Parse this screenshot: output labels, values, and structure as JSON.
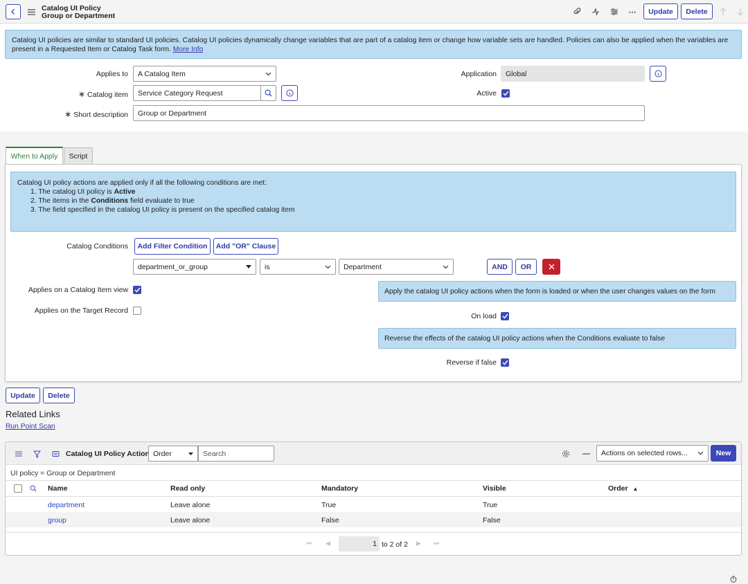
{
  "header": {
    "record_type": "Catalog UI Policy",
    "record_name": "Group or Department",
    "update_label": "Update",
    "delete_label": "Delete"
  },
  "intro_banner": {
    "text": "Catalog UI policies are similar to standard UI policies. Catalog UI policies dynamically change variables that are part of a catalog item or change how variable sets are handled. Policies can also be applied when the variables are present in a Requested Item or Catalog Task form.",
    "link_label": "More Info"
  },
  "form": {
    "applies_to_label": "Applies to",
    "applies_to_value": "A Catalog Item",
    "catalog_item_label": "Catalog item",
    "catalog_item_value": "Service Category Request",
    "short_description_label": "Short description",
    "short_description_value": "Group or Department",
    "application_label": "Application",
    "application_value": "Global",
    "active_label": "Active",
    "required_marker": "∗"
  },
  "tabs": [
    {
      "label": "When to Apply",
      "active": true
    },
    {
      "label": "Script",
      "active": false
    }
  ],
  "conditions_banner": {
    "intro": "Catalog UI policy actions are applied only if all the following conditions are met:",
    "item1_prefix": "1. The catalog UI policy is ",
    "item1_bold": "Active",
    "item2_prefix": "2. The items in the ",
    "item2_bold": "Conditions",
    "item2_suffix": " field evaluate to true",
    "item3": "3. The field specified in the catalog UI policy is present on the specified catalog item"
  },
  "conditions": {
    "label": "Catalog Conditions",
    "add_filter_label": "Add Filter Condition",
    "add_or_label": "Add \"OR\" Clause",
    "field": "department_or_group",
    "operator": "is",
    "value": "Department",
    "and_label": "AND",
    "or_label": "OR"
  },
  "options": {
    "applies_catalog_view_label": "Applies on a Catalog Item view",
    "applies_catalog_view": true,
    "applies_target_label": "Applies on the Target Record",
    "applies_target": false,
    "onload_hint": "Apply the catalog UI policy actions when the form is loaded or when the user changes values on the form",
    "onload_label": "On load",
    "onload": true,
    "reverse_hint": "Reverse the effects of the catalog UI policy actions when the Conditions evaluate to false",
    "reverse_label": "Reverse if false",
    "reverse": true
  },
  "footer_buttons": {
    "update_label": "Update",
    "delete_label": "Delete"
  },
  "related_links": {
    "title": "Related Links",
    "run_point_scan": "Run Point Scan"
  },
  "related_list": {
    "title": "Catalog UI Policy Actions",
    "search_field": "Order",
    "search_placeholder": "Search",
    "actions_select": "Actions on selected rows...",
    "new_label": "New",
    "breadcrumb": "UI policy = Group or Department",
    "columns": [
      "Name",
      "Read only",
      "Mandatory",
      "Visible",
      "Order"
    ],
    "rows": [
      {
        "name": "department",
        "read_only": "Leave alone",
        "mandatory": "True",
        "visible": "True",
        "order": ""
      },
      {
        "name": "group",
        "read_only": "Leave alone",
        "mandatory": "False",
        "visible": "False",
        "order": ""
      }
    ],
    "pagination": {
      "current": "1",
      "range_text": "to 2 of 2"
    }
  },
  "colors": {
    "accent": "#3c48b8",
    "banner": "#bcdcf2",
    "delete_red": "#c41f2e",
    "tab_green": "#2a7d3e"
  }
}
